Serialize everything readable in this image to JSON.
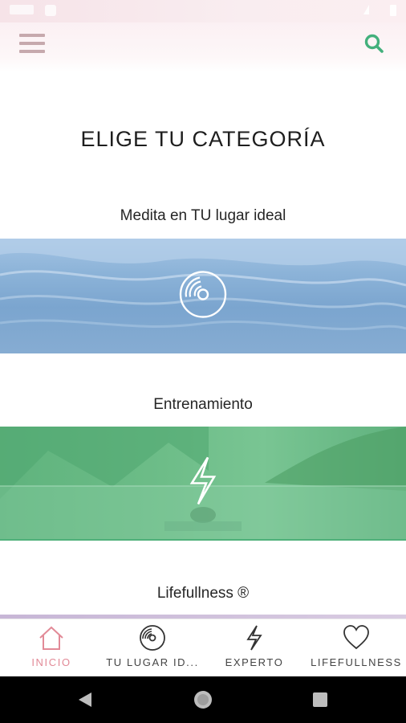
{
  "status_bar": {
    "icons": [
      "time-placeholder",
      "notification-icon",
      "signal-icon",
      "battery-icon"
    ]
  },
  "app_bar": {
    "menu_icon": "hamburger-menu-icon",
    "search_icon": "search-icon",
    "accent_color": "#43b07c",
    "menu_color": "#c6a9ad"
  },
  "page": {
    "title": "ELIGE TU CATEGORÍA"
  },
  "categories": [
    {
      "label": "Medita en TU lugar ideal",
      "icon": "vinyl-disc-icon"
    },
    {
      "label": "Entrenamiento",
      "icon": "lightning-bolt-icon"
    },
    {
      "label": "Lifefullness ®",
      "icon": "heart-icon"
    }
  ],
  "bottom_nav": {
    "items": [
      {
        "label": "INICIO",
        "icon": "home-icon",
        "active": true
      },
      {
        "label": "TU LUGAR ID...",
        "icon": "vinyl-disc-icon",
        "active": false
      },
      {
        "label": "EXPERTO",
        "icon": "lightning-bolt-icon",
        "active": false
      },
      {
        "label": "LIFEFULLNESS",
        "icon": "heart-icon",
        "active": false
      }
    ],
    "active_color": "#e28a97"
  },
  "system_nav": {
    "buttons": [
      "back-icon",
      "home-circle-icon",
      "recent-apps-icon"
    ]
  }
}
